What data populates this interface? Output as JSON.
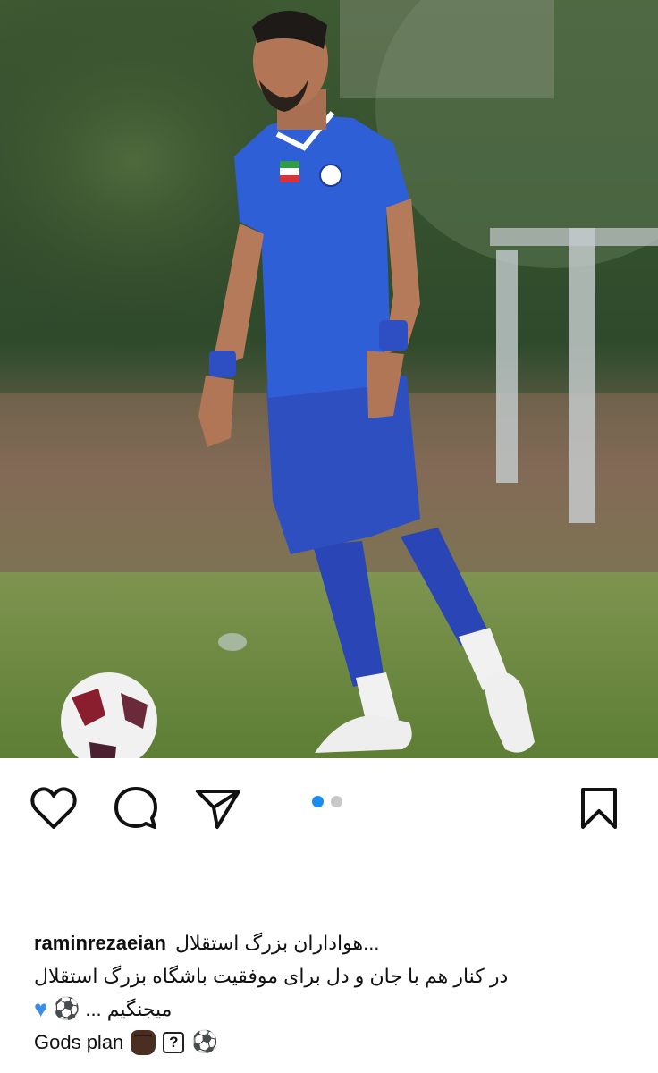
{
  "post": {
    "photo_alt": "",
    "carousel": {
      "count": 2,
      "active": 0
    }
  },
  "actions": {
    "like_icon": "heart-outline-icon",
    "comment_icon": "comment-bubble-icon",
    "share_icon": "paper-plane-icon",
    "save_icon": "bookmark-icon"
  },
  "caption": {
    "username": "raminrezaeian",
    "line1_text": "...هواداران بزرگ استقلال",
    "line2_text": "در کنار هم با جان و دل برای موفقیت باشگاه بزرگ استقلال",
    "line3_text": "میجنگیم ...",
    "line4_text": "Gods plan",
    "emojis": [
      "blue-heart",
      "soccer-ball",
      "raised-fist-dark",
      "question-box",
      "soccer-ball"
    ]
  },
  "colors": {
    "accent_blue": "#1a8cf0",
    "kit_blue": "#2a55c8",
    "heart_blue": "#3a8ee6"
  }
}
